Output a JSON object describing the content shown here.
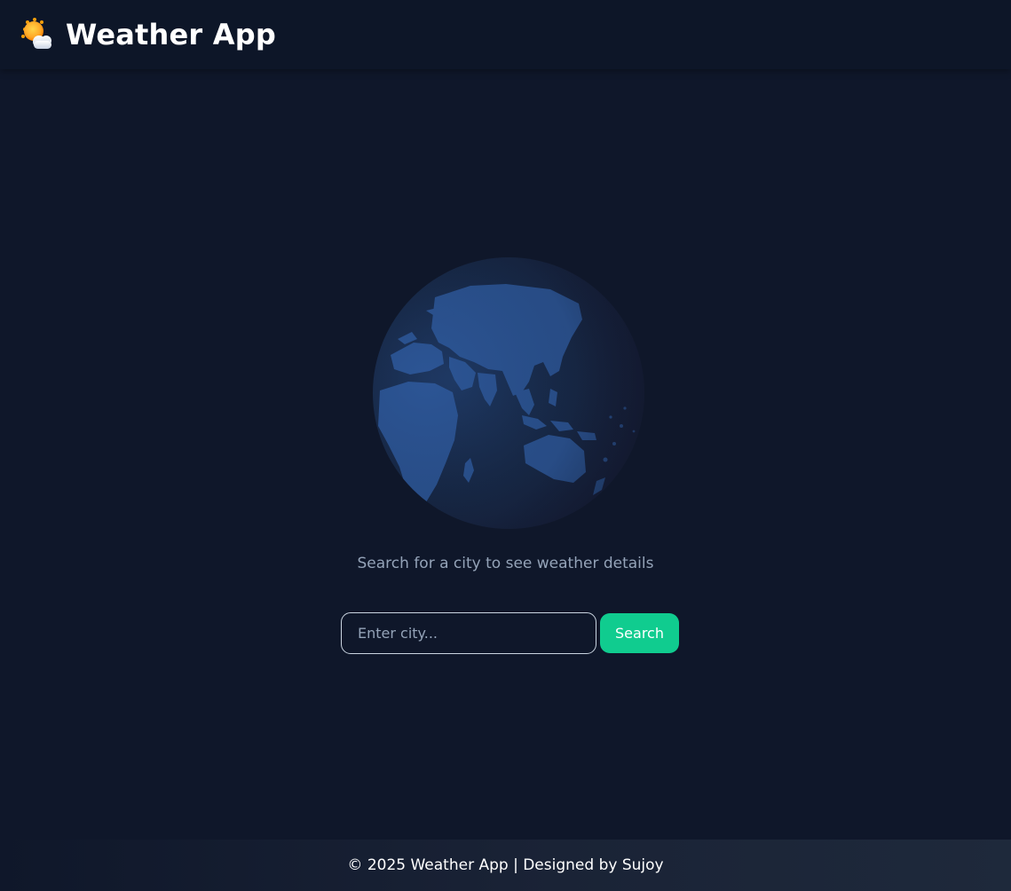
{
  "header": {
    "title": "Weather App",
    "logo_icon": "sun-behind-cloud-icon"
  },
  "main": {
    "globe_icon": "globe-icon",
    "prompt": "Search for a city to see weather details",
    "search": {
      "placeholder": "Enter city...",
      "value": "",
      "button_label": "Search"
    }
  },
  "footer": {
    "text": "© 2025 Weather App | Designed by Sujoy"
  },
  "colors": {
    "background": "#0f172a",
    "accent": "#10cc8f",
    "muted_text": "#94a3b8",
    "globe_land": "#2c5595"
  }
}
